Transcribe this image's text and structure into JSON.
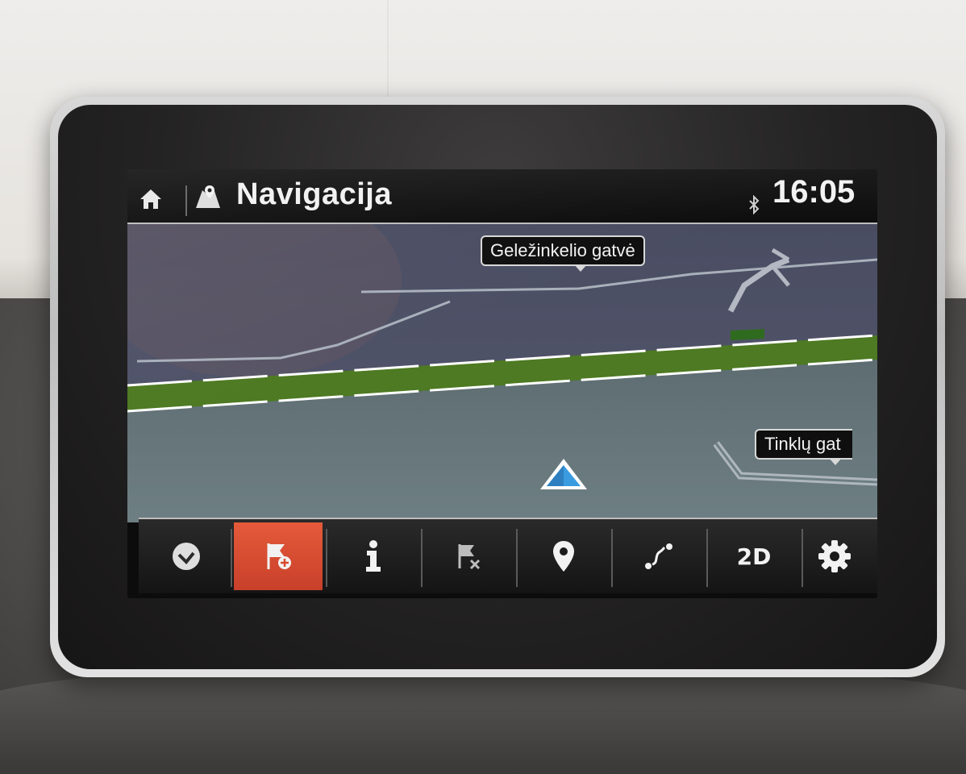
{
  "status_bar": {
    "title": "Navigacija",
    "time": "16:05",
    "home_icon": "home-icon",
    "app_icon": "navigation-app-icon",
    "connectivity_icon": "bluetooth-icon"
  },
  "map": {
    "street_labels": [
      "Geležinkelio gatvė",
      "Tinklų gat"
    ],
    "position_marker": "position-arrow-icon",
    "colors": {
      "route": "#4d7a22",
      "road": "#5f6d72",
      "marker": "#3a9be0"
    }
  },
  "toolbar": {
    "buttons": [
      {
        "name": "confirm-button",
        "icon": "checkmark-icon",
        "active": false
      },
      {
        "name": "add-waypoint-button",
        "icon": "flag-plus-icon",
        "active": true
      },
      {
        "name": "info-button",
        "icon": "info-icon",
        "active": false
      },
      {
        "name": "cancel-route-button",
        "icon": "flag-x-icon",
        "active": false
      },
      {
        "name": "destination-button",
        "icon": "map-pin-icon",
        "active": false
      },
      {
        "name": "route-options-button",
        "icon": "route-icon",
        "active": false
      },
      {
        "name": "view-mode-button",
        "icon": "view-2d-icon",
        "label": "2D",
        "active": false
      },
      {
        "name": "settings-button",
        "icon": "gear-icon",
        "active": false
      }
    ],
    "active_color": "#d84a2e"
  }
}
